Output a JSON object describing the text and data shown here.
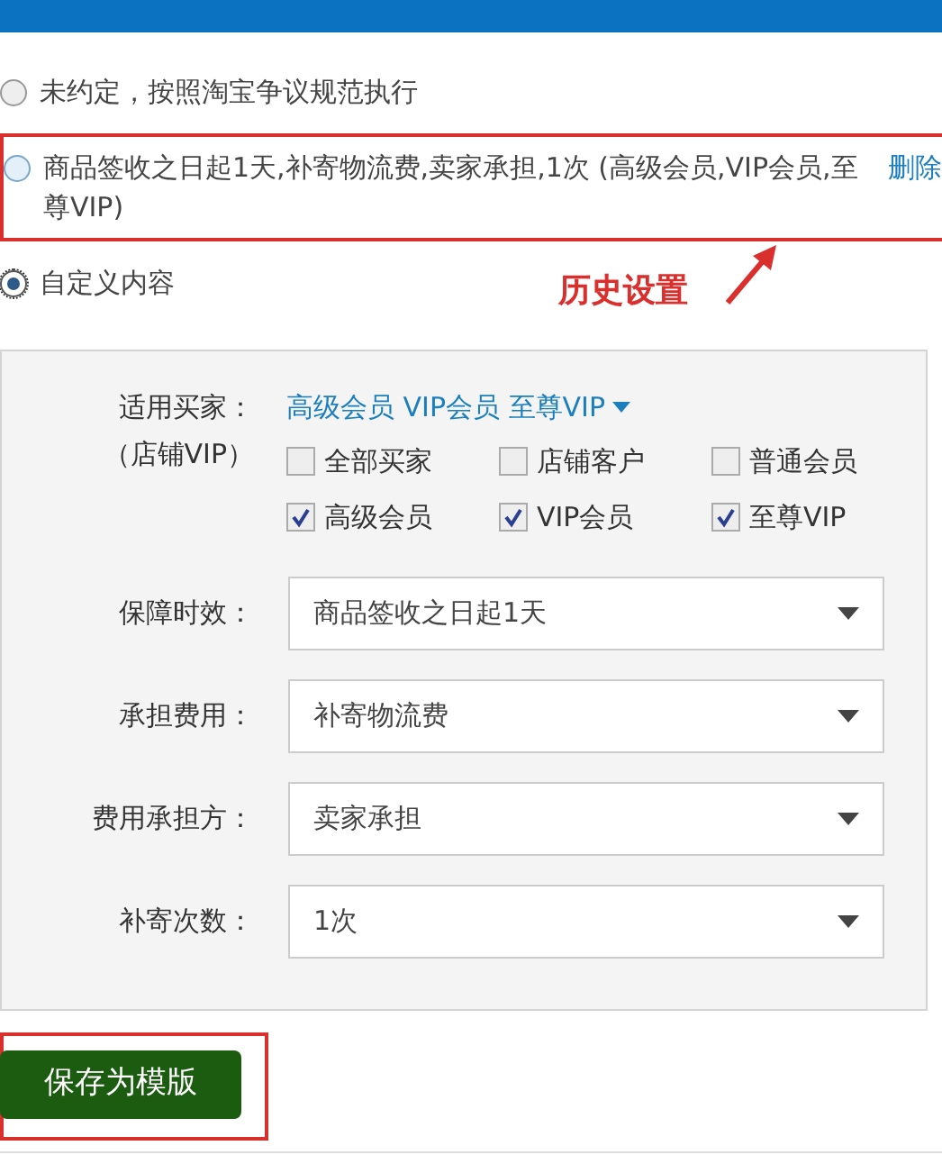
{
  "options": [
    {
      "label": "未约定，按照淘宝争议规范执行",
      "selected": false,
      "highlighted": false
    },
    {
      "label": "商品签收之日起1天,补寄物流费,卖家承担,1次 (高级会员,VIP会员,至尊VIP)",
      "selected": false,
      "highlighted": true,
      "link": "删除"
    },
    {
      "label": "自定义内容",
      "selected": true,
      "highlighted": false
    }
  ],
  "annotation": "历史设置",
  "buyers": {
    "label": "适用买家：",
    "sublabel": "（店铺VIP）",
    "summary": "高级会员 VIP会员 至尊VIP",
    "checkboxes": [
      {
        "label": "全部买家",
        "checked": false
      },
      {
        "label": "店铺客户",
        "checked": false
      },
      {
        "label": "普通会员",
        "checked": false
      },
      {
        "label": "高级会员",
        "checked": true
      },
      {
        "label": "VIP会员",
        "checked": true
      },
      {
        "label": "至尊VIP",
        "checked": true
      }
    ]
  },
  "fields": [
    {
      "label": "保障时效：",
      "value": "商品签收之日起1天"
    },
    {
      "label": "承担费用：",
      "value": "补寄物流费"
    },
    {
      "label": "费用承担方：",
      "value": "卖家承担"
    },
    {
      "label": "补寄次数：",
      "value": "1次"
    }
  ],
  "save_button": "保存为模版"
}
